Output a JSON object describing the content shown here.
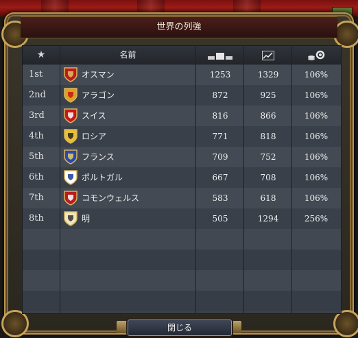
{
  "window": {
    "title": "世界の列強"
  },
  "header": {
    "rank_icon": "star-icon",
    "name_label": "名前",
    "col1_icon": "power-bars-icon",
    "col2_icon": "trend-chart-icon",
    "col3_icon": "coins-gear-icon"
  },
  "rows": [
    {
      "rank": "1st",
      "name": "オスマン",
      "v1": "1253",
      "v2": "1329",
      "v3": "106%",
      "shield_colors": [
        "#b81d1d",
        "#e0c060"
      ]
    },
    {
      "rank": "2nd",
      "name": "アラゴン",
      "v1": "872",
      "v2": "925",
      "v3": "106%",
      "shield_colors": [
        "#e0a020",
        "#c01818"
      ]
    },
    {
      "rank": "3rd",
      "name": "スイス",
      "v1": "816",
      "v2": "866",
      "v3": "106%",
      "shield_colors": [
        "#c81818",
        "#ffffff"
      ]
    },
    {
      "rank": "4th",
      "name": "ロシア",
      "v1": "771",
      "v2": "818",
      "v3": "106%",
      "shield_colors": [
        "#e8c030",
        "#222222"
      ]
    },
    {
      "rank": "5th",
      "name": "フランス",
      "v1": "709",
      "v2": "752",
      "v3": "106%",
      "shield_colors": [
        "#2a4ab0",
        "#e8d060"
      ]
    },
    {
      "rank": "6th",
      "name": "ポルトガル",
      "v1": "667",
      "v2": "708",
      "v3": "106%",
      "shield_colors": [
        "#ffffff",
        "#1a3a9a"
      ]
    },
    {
      "rank": "7th",
      "name": "コモンウェルス",
      "v1": "583",
      "v2": "618",
      "v3": "106%",
      "shield_colors": [
        "#b81d1d",
        "#ffffff"
      ]
    },
    {
      "rank": "8th",
      "name": "明",
      "v1": "505",
      "v2": "1294",
      "v3": "256%",
      "shield_colors": [
        "#f0e6c0",
        "#333333"
      ]
    }
  ],
  "empty_rows": 4,
  "close_button": {
    "label": "閉じる"
  }
}
